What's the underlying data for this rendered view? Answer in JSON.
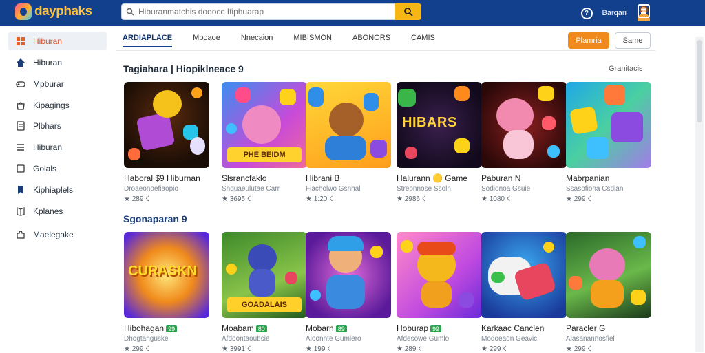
{
  "app": {
    "logo_text": "dayphaks"
  },
  "search": {
    "placeholder": "Hiburanmatchis dooocc Ifiphuarap"
  },
  "topbar": {
    "user_label": "Barqari"
  },
  "sidebar": {
    "items": [
      {
        "label": "Hiburan",
        "icon": "grid-icon",
        "active": true
      },
      {
        "label": "Hiburan",
        "icon": "home-icon",
        "active": false
      },
      {
        "label": "Mpburar",
        "icon": "gamepad-icon",
        "active": false
      },
      {
        "label": "Kipagings",
        "icon": "bag-icon",
        "active": false
      },
      {
        "label": "Plbhars",
        "icon": "doc-icon",
        "active": false
      },
      {
        "label": "Hiburan",
        "icon": "list-icon",
        "active": false
      },
      {
        "label": "Golals",
        "icon": "cube-icon",
        "active": false
      },
      {
        "label": "Kiphiaplels",
        "icon": "bookmark-icon",
        "active": false
      },
      {
        "label": "Kplanes",
        "icon": "book-icon",
        "active": false
      },
      {
        "label": "Maelegake",
        "icon": "puzzle-icon",
        "active": false
      }
    ]
  },
  "tabs": [
    {
      "label": "ARDIAPLACE",
      "active": true
    },
    {
      "label": "Mpoaoe",
      "active": false
    },
    {
      "label": "Nnecaion",
      "active": false
    },
    {
      "label": "MIBISMON",
      "active": false
    },
    {
      "label": "ABONORS",
      "active": false
    },
    {
      "label": "CAMIS",
      "active": false
    }
  ],
  "actions": {
    "primary": "Plamria",
    "secondary": "Same"
  },
  "section1": {
    "title": "Tagiahara | Hiopiklneace 9",
    "see_all": "Granitacis"
  },
  "section2": {
    "title": "Sgonaparan 9"
  },
  "row1": [
    {
      "title": "Haboral $9 Hiburnan",
      "sub": "Droaeonoefiaopio",
      "stat": "★ 289 ☇",
      "badge": "",
      "banner": ""
    },
    {
      "title": "Slsrancfaklo",
      "sub": "Shquaeulutae Carr",
      "stat": "★ 3695 ☇",
      "badge": "",
      "banner": "PHE BEIDM"
    },
    {
      "title": "Hibrani B",
      "sub": "Fiacholwo Gsnhal",
      "stat": "★ 1:20 ☇",
      "badge": "",
      "banner": ""
    },
    {
      "title": "Halurann 🟡 Game",
      "sub": "Streonnose Ssoln",
      "stat": "★ 2986 ☇",
      "badge": "",
      "banner": ""
    },
    {
      "title": "Paburan N",
      "sub": "Sodionoa Gsuie",
      "stat": "★ 1080 ☇",
      "badge": "",
      "banner": ""
    },
    {
      "title": "Mabrpanian",
      "sub": "Ssasofiona Csdian",
      "stat": "★ 299 ☇",
      "badge": "",
      "banner": ""
    }
  ],
  "row2": [
    {
      "title": "Hibohagan",
      "sub": "Dhogtahguske",
      "stat": "★ 299 ☇",
      "badge": "99",
      "banner": ""
    },
    {
      "title": "Moabam",
      "sub": "Afdoontaoubsie",
      "stat": "★ 3991 ☇",
      "badge": "80",
      "banner": "GOADALAIS"
    },
    {
      "title": "Mobarn",
      "sub": "Aloonnte Gumlero",
      "stat": "★ 199 ☇",
      "badge": "89",
      "banner": ""
    },
    {
      "title": "Hoburap",
      "sub": "Afdesowe Gumlo",
      "stat": "★ 289 ☇",
      "badge": "99",
      "banner": ""
    },
    {
      "title": "Karkaac Canclen",
      "sub": "Modoeaon Geavic",
      "stat": "★ 299 ☇",
      "badge": "",
      "banner": ""
    },
    {
      "title": "Paracler G",
      "sub": "Alasanannosfiel",
      "stat": "★ 299 ☇",
      "badge": "",
      "banner": ""
    }
  ],
  "thumb_texts": {
    "r1c4": "HIBARS",
    "r2c1": "CURASKN"
  },
  "colors": {
    "topbar": "#12408c",
    "accent": "#f08a1c",
    "search_button": "#f6b614"
  }
}
